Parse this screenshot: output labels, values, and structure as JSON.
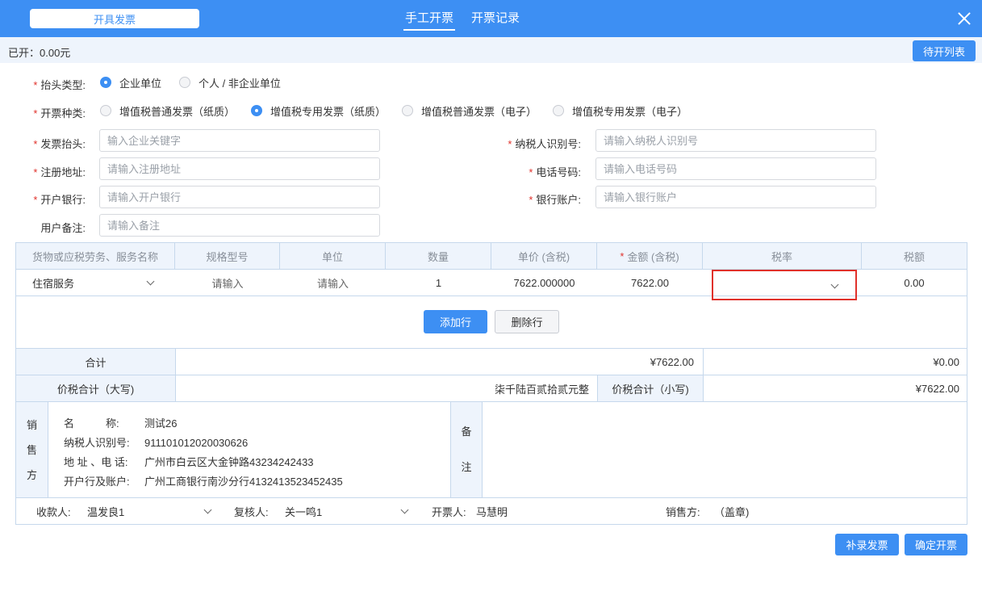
{
  "topbar": {
    "title_button": "开具发票",
    "tabs": [
      {
        "label": "手工开票",
        "active": true
      },
      {
        "label": "开票记录",
        "active": false
      }
    ],
    "accent_color": "#3d8ff3"
  },
  "subbar": {
    "issued": "已开：0.00元",
    "pending_button": "待开列表"
  },
  "form": {
    "header_type": {
      "label": "抬头类型:",
      "options": [
        "企业单位",
        "个人 / 非企业单位"
      ],
      "selected": "企业单位"
    },
    "invoice_type": {
      "label": "开票种类:",
      "options": [
        "增值税普通发票（纸质）",
        "增值税专用发票（纸质）",
        "增值税普通发票（电子）",
        "增值税专用发票（电子）"
      ],
      "selected": "增值税专用发票（纸质）"
    },
    "title": {
      "label": "发票抬头:",
      "placeholder": "输入企业关键字",
      "value": ""
    },
    "taxpayer_id": {
      "label": "纳税人识别号:",
      "placeholder": "请输入纳税人识别号",
      "value": ""
    },
    "address": {
      "label": "注册地址:",
      "placeholder": "请输入注册地址",
      "value": ""
    },
    "phone": {
      "label": "电话号码:",
      "placeholder": "请输入电话号码",
      "value": ""
    },
    "bank": {
      "label": "开户银行:",
      "placeholder": "请输入开户银行",
      "value": ""
    },
    "account": {
      "label": "银行账户:",
      "placeholder": "请输入银行账户",
      "value": ""
    },
    "remark": {
      "label": "用户备注:",
      "placeholder": "请输入备注",
      "value": ""
    }
  },
  "table": {
    "headers": [
      "货物或应税劳务、服务名称",
      "规格型号",
      "单位",
      "数量",
      "单价 (含税)",
      "金额 (含税)",
      "税率",
      "税额"
    ],
    "row": {
      "name": "住宿服务",
      "spec": "请输入",
      "unit": "请输入",
      "qty": "1",
      "price": "7622.000000",
      "amount": "7622.00",
      "rate": "",
      "tax": "0.00"
    },
    "add_row": "添加行",
    "delete_row": "删除行"
  },
  "totals": {
    "label": "合计",
    "amount": "¥7622.00",
    "tax": "¥0.00",
    "capital_label": "价税合计（大写)",
    "capital_value": "柒千陆百贰拾贰元整",
    "small_label": "价税合计（小写)",
    "small_value": "¥7622.00"
  },
  "seller": {
    "side_chars": [
      "销",
      "售",
      "方"
    ],
    "name_label": "名　　　称:",
    "name": "测试26",
    "taxid_label": "纳税人识别号:",
    "taxid": "911101012020030626",
    "addr_label": "地 址 、电 话:",
    "addr": "广州市白云区大金钟路43234242433",
    "bank_label": "开户行及账户:",
    "bank": "广州工商银行南沙分行4132413523452435",
    "note_chars": [
      "备",
      "注"
    ]
  },
  "signatures": {
    "payee_label": "收款人:",
    "payee": "温发良1",
    "reviewer_label": "复核人:",
    "reviewer": "关一鸣1",
    "drawer_label": "开票人:",
    "drawer": "马慧明",
    "seller_label": "销售方:",
    "seller": "（盖章)"
  },
  "footer": {
    "supplement": "补录发票",
    "confirm": "确定开票"
  }
}
